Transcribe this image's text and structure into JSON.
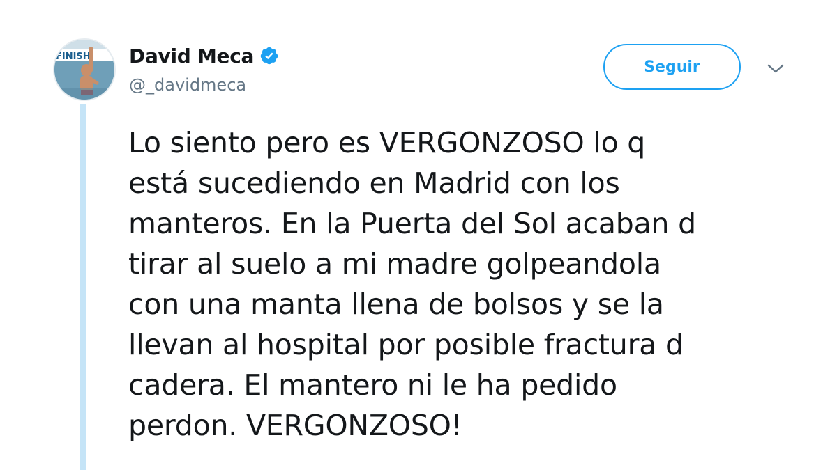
{
  "user": {
    "display_name": "David Meca",
    "handle": "@_davidmeca",
    "avatar_banner_text": "FINISH"
  },
  "follow_button": {
    "label": "Seguir"
  },
  "icons": {
    "verified": "verified-badge-icon",
    "menu": "chevron-down-icon"
  },
  "colors": {
    "accent": "#1da1f2",
    "thread_line": "#c5e4f7",
    "text": "#14171a",
    "secondary_text": "#657786"
  },
  "tweet": {
    "lines": [
      "Lo siento pero es VERGONZOSO lo q",
      "está sucediendo en Madrid con los",
      "manteros. En la Puerta del Sol acaban d",
      "tirar al suelo a mi madre golpeandola",
      "con una manta llena de bolsos y se la",
      "llevan al hospital por posible fractura d",
      "cadera. El mantero ni le ha pedido",
      "perdon. VERGONZOSO!"
    ]
  }
}
